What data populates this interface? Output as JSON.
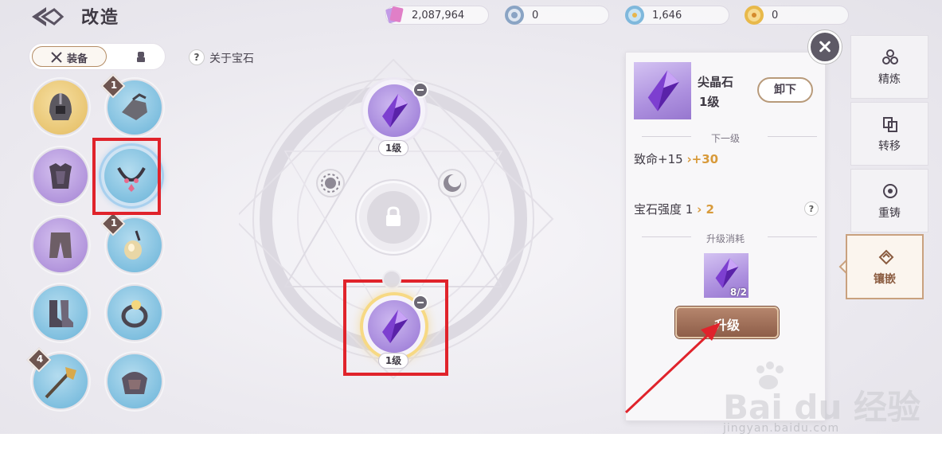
{
  "header": {
    "title": "改造",
    "currencies": [
      {
        "icon": "crystal-cards-icon",
        "value": "2,087,964"
      },
      {
        "icon": "silver-emblem-icon",
        "value": "0"
      },
      {
        "icon": "blue-coin-icon",
        "value": "1,646"
      },
      {
        "icon": "gold-coin-icon",
        "value": "0"
      }
    ]
  },
  "left_tabs": {
    "equip_label": "装备"
  },
  "equipment_slots": [
    {
      "name": "helmet",
      "rarity": "gold",
      "badge": ""
    },
    {
      "name": "gauntlet",
      "rarity": "blue",
      "badge": "1"
    },
    {
      "name": "armor",
      "rarity": "purple",
      "badge": ""
    },
    {
      "name": "necklace",
      "rarity": "blue",
      "badge": "",
      "selected": true
    },
    {
      "name": "pants",
      "rarity": "purple",
      "badge": ""
    },
    {
      "name": "pendant",
      "rarity": "blue",
      "badge": "1"
    },
    {
      "name": "boots",
      "rarity": "blue",
      "badge": ""
    },
    {
      "name": "ring",
      "rarity": "blue",
      "badge": ""
    },
    {
      "name": "weapon",
      "rarity": "blue",
      "badge": "4"
    },
    {
      "name": "shoulder",
      "rarity": "blue",
      "badge": ""
    }
  ],
  "about_gem": "关于宝石",
  "gem_sockets": {
    "top_level": "1级",
    "bottom_level": "1级"
  },
  "detail": {
    "gem_name": "尖晶石",
    "gem_level": "1级",
    "unequip_label": "卸下",
    "next_level_title": "下一级",
    "stat_text": "致命+15",
    "stat_next": "›+30",
    "strength_label": "宝石强度",
    "strength_from": "1",
    "strength_to": "› 2",
    "cost_title": "升级消耗",
    "cost_count": "8/2",
    "upgrade_label": "升级"
  },
  "side_tabs": [
    {
      "label": "精炼",
      "icon": "refine-icon"
    },
    {
      "label": "转移",
      "icon": "transfer-icon"
    },
    {
      "label": "重铸",
      "icon": "recast-icon"
    },
    {
      "label": "镶嵌",
      "icon": "inlay-icon",
      "active": true
    }
  ],
  "watermark": {
    "logo": "Bai du 经验",
    "url": "jingyan.baidu.com"
  },
  "colors": {
    "highlight_box": "#e0232b",
    "accent": "#c9a17e",
    "gem_purple": "#a688dc"
  }
}
